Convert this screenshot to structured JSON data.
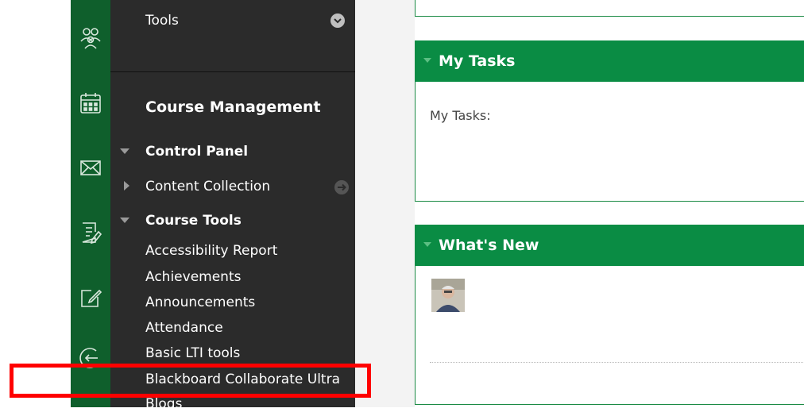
{
  "menu": {
    "tools_label": "Tools",
    "section_title": "Course Management",
    "control_panel": "Control Panel",
    "content_collection": "Content Collection",
    "course_tools": "Course Tools",
    "course_tool_items": [
      "Accessibility Report",
      "Achievements",
      "Announcements",
      "Attendance",
      "Basic LTI tools",
      "Blackboard Collaborate Ultra",
      "Blogs"
    ]
  },
  "modules": {
    "my_tasks": {
      "title": "My Tasks",
      "body": "My Tasks:"
    },
    "whats_new": {
      "title": "What's New"
    }
  },
  "colors": {
    "rail": "#0f5f2c",
    "menu_bg": "#2b2b2b",
    "module_header": "#0a8c44",
    "highlight": "#ff0000"
  },
  "rail_icons": [
    "groups-icon",
    "calendar-icon",
    "messages-icon",
    "grades-icon",
    "edit-icon",
    "sign-out-icon"
  ]
}
